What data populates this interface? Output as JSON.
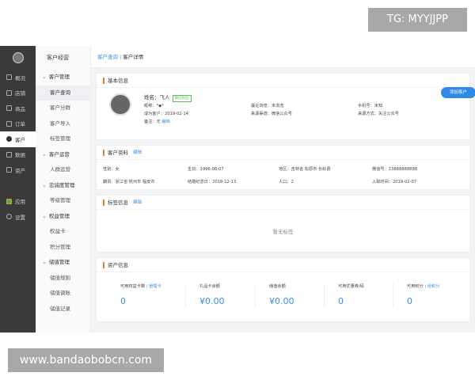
{
  "watermarks": {
    "top": "TG: MYYJJPP",
    "bottom": "www.bandaobobcn.com"
  },
  "leftnav": {
    "items": [
      {
        "label": "概况",
        "icon": "monitor-icon"
      },
      {
        "label": "店铺",
        "icon": "store-icon"
      },
      {
        "label": "商品",
        "icon": "tag-icon"
      },
      {
        "label": "订单",
        "icon": "order-icon"
      },
      {
        "label": "客户",
        "icon": "user-icon"
      },
      {
        "label": "数据",
        "icon": "chart-icon"
      },
      {
        "label": "资产",
        "icon": "wallet-icon"
      }
    ],
    "bottom_items": [
      {
        "label": "应用",
        "icon": "apps-icon"
      },
      {
        "label": "设置",
        "icon": "gear-icon"
      }
    ]
  },
  "subnav": {
    "title": "客户经营",
    "groups": [
      {
        "label": "客户管理",
        "items": [
          "客户查询",
          "客户分群",
          "客户导入",
          "标签管理"
        ]
      },
      {
        "label": "客户运营",
        "items": [
          "人群运营"
        ]
      },
      {
        "label": "忠诚度管理",
        "items": [
          "等级管理"
        ]
      },
      {
        "label": "权益管理",
        "items": [
          "权益卡",
          "积分管理"
        ]
      },
      {
        "label": "储值管理",
        "items": [
          "储值规则",
          "储值调账",
          "储值记录"
        ]
      }
    ]
  },
  "breadcrumb": {
    "parent": "客户查询",
    "separator": "|",
    "current": "客户详情"
  },
  "basic": {
    "title": "基本信息",
    "name_label": "姓名：",
    "name_value": "飞人",
    "badge": "微信粉丝",
    "nickname": "昵称：*◆*",
    "become_customer": "成为客户：2019-02-14",
    "remark": "备注：无",
    "remark_edit": "编辑",
    "last_visit": "最近浏览：未浏览",
    "source_channel": "来源渠道：微信公众号",
    "phone": "手机号：未知",
    "source_method": "来源方式：关注公众号",
    "add_button": "添加客户"
  },
  "profile": {
    "title": "客户资料",
    "edit": "编辑",
    "gender": "性别：女",
    "birthday": "生日：1996-06-07",
    "region": "地区：吉林省 松原市 长岭县",
    "wechat": "微信号：13888888888",
    "hometown": "籍贯：浙江省 杭州市 临安市",
    "anniversary": "结婚纪念日：2018-12-13",
    "population": "人口：2",
    "join_date": "入职时间：2019-02-07"
  },
  "tags": {
    "title": "标签信息",
    "edit": "编辑",
    "empty": "暂无标签"
  },
  "assets": {
    "title": "资产信息",
    "cols": [
      {
        "label": "可用权益卡数",
        "link": "管理卡",
        "value": "0"
      },
      {
        "label": "礼品卡余额",
        "link": "",
        "value": "¥0.00"
      },
      {
        "label": "储值余额",
        "link": "",
        "value": "¥0.00"
      },
      {
        "label": "可用优惠券/码",
        "link": "",
        "value": "0"
      },
      {
        "label": "可用积分",
        "link": "给积分",
        "value": "0"
      }
    ]
  }
}
